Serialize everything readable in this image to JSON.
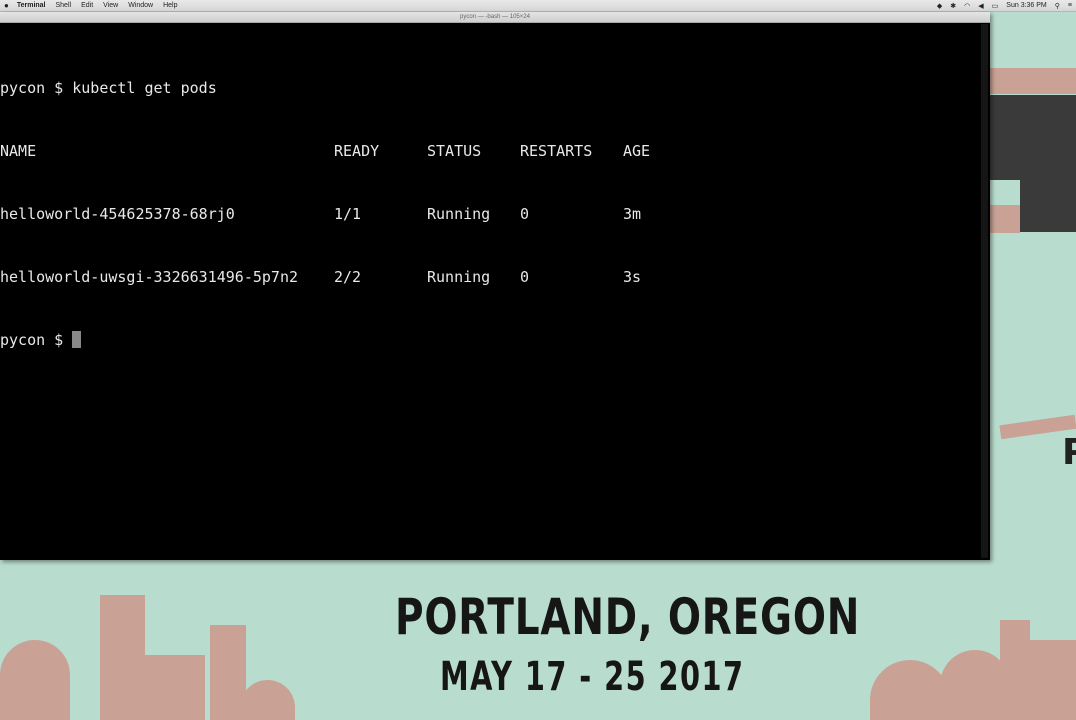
{
  "menubar": {
    "apple": "",
    "items": [
      "Terminal",
      "Shell",
      "Edit",
      "View",
      "Window",
      "Help"
    ],
    "clock": "Sun 3:36 PM"
  },
  "terminal": {
    "title": "pycon — -bash — 105×24",
    "lines": [
      {
        "prompt": "pycon $ ",
        "cmd": "kubectl get pods"
      },
      {
        "cols": [
          "NAME",
          "READY",
          "STATUS",
          "RESTARTS",
          "AGE"
        ]
      },
      {
        "cols": [
          "helloworld-454625378-68rj0",
          "1/1",
          "Running",
          "0",
          "3m"
        ]
      },
      {
        "cols": [
          "helloworld-uwsgi-3326631496-5p7n2",
          "2/2",
          "Running",
          "0",
          "3s"
        ]
      },
      {
        "prompt": "pycon $ ",
        "cmd": ""
      }
    ]
  },
  "slide": {
    "title": "PORTLAND, OREGON",
    "dates": "MAY 17 - 25 2017",
    "side_letter": "P"
  }
}
